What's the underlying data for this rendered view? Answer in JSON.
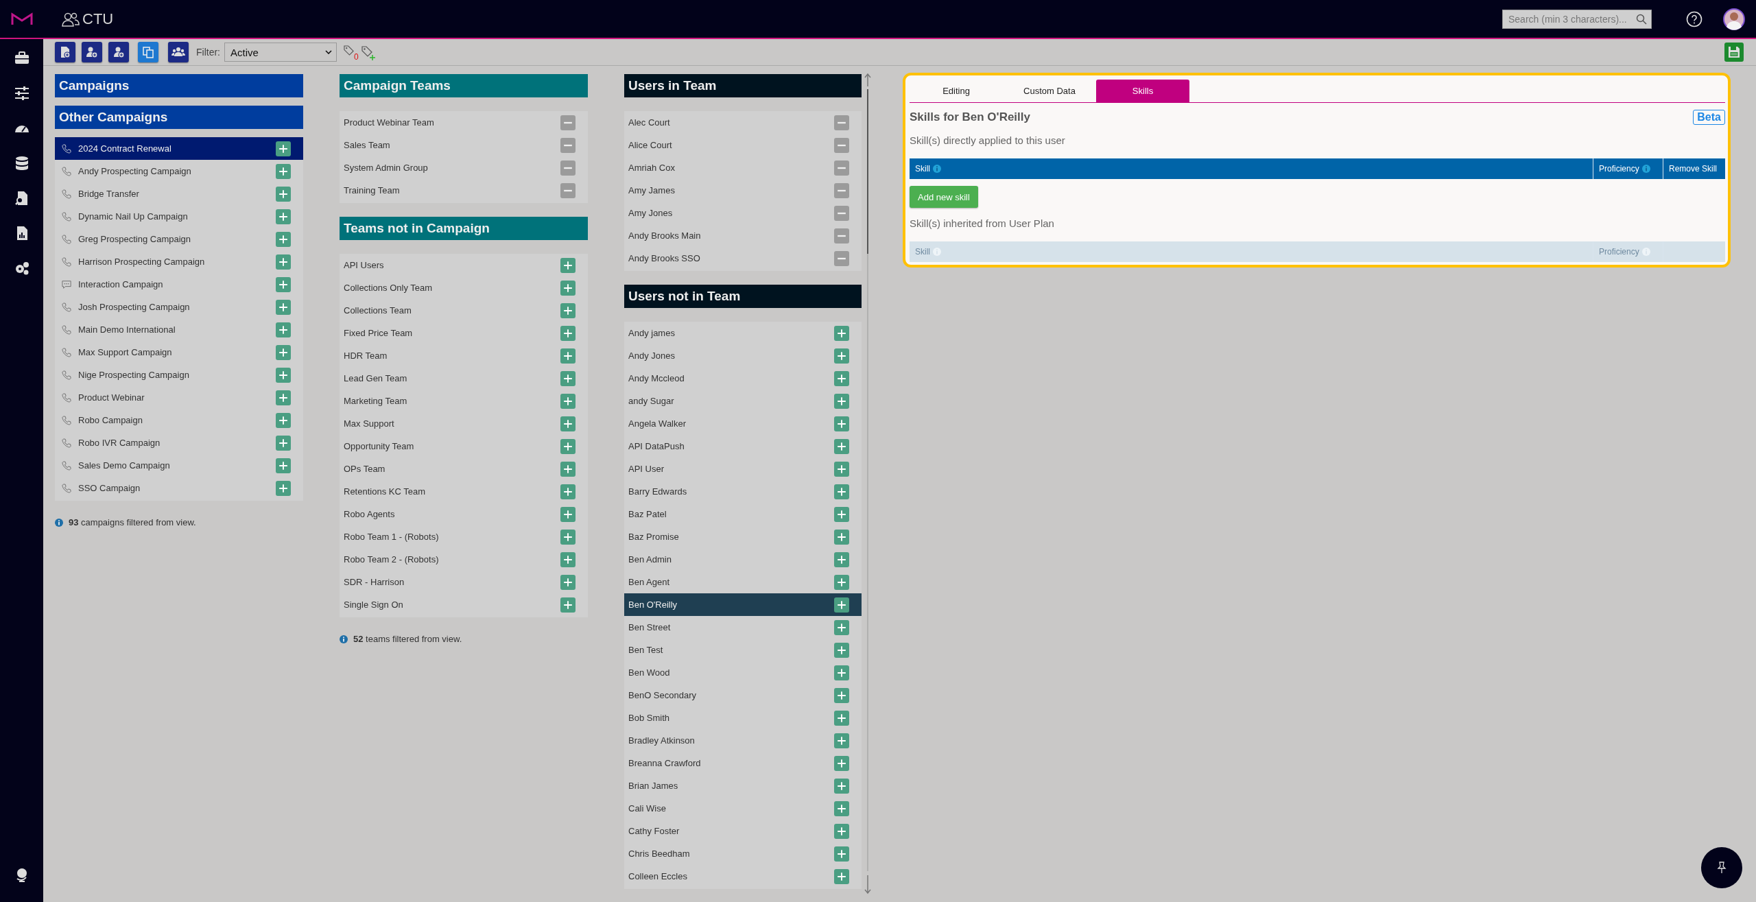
{
  "app": {
    "title": "CTU"
  },
  "search": {
    "placeholder": "Search (min 3 characters)..."
  },
  "toolbar": {
    "filter_label": "Filter:",
    "filter_value": "Active",
    "tag_count": "0"
  },
  "campaigns": {
    "title": "Campaigns",
    "other_title": "Other Campaigns",
    "items": [
      {
        "name": "2024 Contract Renewal",
        "kind": "phone",
        "selected": true
      },
      {
        "name": "Andy Prospecting Campaign",
        "kind": "phone",
        "selected": false
      },
      {
        "name": "Bridge Transfer",
        "kind": "phone",
        "selected": false
      },
      {
        "name": "Dynamic Nail Up Campaign",
        "kind": "phone",
        "selected": false
      },
      {
        "name": "Greg Prospecting Campaign",
        "kind": "phone",
        "selected": false
      },
      {
        "name": "Harrison Prospecting Campaign",
        "kind": "phone",
        "selected": false
      },
      {
        "name": "Interaction Campaign",
        "kind": "chat",
        "selected": false
      },
      {
        "name": "Josh Prospecting Campaign",
        "kind": "phone",
        "selected": false
      },
      {
        "name": "Main Demo International",
        "kind": "phone",
        "selected": false
      },
      {
        "name": "Max Support Campaign",
        "kind": "phone",
        "selected": false
      },
      {
        "name": "Nige Prospecting Campaign",
        "kind": "phone",
        "selected": false
      },
      {
        "name": "Product Webinar",
        "kind": "phone",
        "selected": false
      },
      {
        "name": "Robo Campaign",
        "kind": "phone",
        "selected": false
      },
      {
        "name": "Robo IVR Campaign",
        "kind": "phone",
        "selected": false
      },
      {
        "name": "Sales Demo Campaign",
        "kind": "phone",
        "selected": false
      },
      {
        "name": "SSO Campaign",
        "kind": "phone",
        "selected": false
      }
    ],
    "footer": "**93** campaigns filtered from view."
  },
  "teams": {
    "in_title": "Campaign Teams",
    "in_items": [
      {
        "name": "Product Webinar Team",
        "selected": false
      },
      {
        "name": "Sales Team",
        "selected": false
      },
      {
        "name": "System Admin Group",
        "selected": false
      },
      {
        "name": "Training Team",
        "selected": false
      }
    ],
    "out_title": "Teams not in Campaign",
    "out_items": [
      {
        "name": "API Users",
        "selected": false
      },
      {
        "name": "Collections Only Team",
        "selected": false
      },
      {
        "name": "Collections Team",
        "selected": false
      },
      {
        "name": "Fixed Price Team",
        "selected": false
      },
      {
        "name": "HDR Team",
        "selected": false
      },
      {
        "name": "Lead Gen Team",
        "selected": false
      },
      {
        "name": "Marketing Team",
        "selected": false
      },
      {
        "name": "Max Support",
        "selected": false
      },
      {
        "name": "Opportunity Team",
        "selected": false
      },
      {
        "name": "OPs Team",
        "selected": false
      },
      {
        "name": "Retentions KC Team",
        "selected": false
      },
      {
        "name": "Robo Agents",
        "selected": false
      },
      {
        "name": "Robo Team 1 - (Robots)",
        "selected": false
      },
      {
        "name": "Robo Team 2 - (Robots)",
        "selected": false
      },
      {
        "name": "SDR - Harrison",
        "selected": false
      },
      {
        "name": "Single Sign On",
        "selected": false
      }
    ],
    "footer": "**52** teams filtered from view."
  },
  "users": {
    "in_title": "Users in Team",
    "in_items": [
      {
        "name": "Alec Court",
        "selected": false
      },
      {
        "name": "Alice Court",
        "selected": false
      },
      {
        "name": "Amriah Cox",
        "selected": false
      },
      {
        "name": "Amy James",
        "selected": false
      },
      {
        "name": "Amy Jones",
        "selected": false
      },
      {
        "name": "Andy Brooks Main",
        "selected": false
      },
      {
        "name": "Andy Brooks SSO",
        "selected": false
      }
    ],
    "out_title": "Users not in Team",
    "out_items": [
      {
        "name": "Andy james",
        "selected": false
      },
      {
        "name": "Andy Jones",
        "selected": false
      },
      {
        "name": "Andy Mccleod",
        "selected": false
      },
      {
        "name": "andy Sugar",
        "selected": false
      },
      {
        "name": "Angela Walker",
        "selected": false
      },
      {
        "name": "API DataPush",
        "selected": false
      },
      {
        "name": "API User",
        "selected": false
      },
      {
        "name": "Barry Edwards",
        "selected": false
      },
      {
        "name": "Baz Patel",
        "selected": false
      },
      {
        "name": "Baz Promise",
        "selected": false
      },
      {
        "name": "Ben Admin",
        "selected": false
      },
      {
        "name": "Ben Agent",
        "selected": false
      },
      {
        "name": "Ben O'Reilly",
        "selected": true
      },
      {
        "name": "Ben Street",
        "selected": false
      },
      {
        "name": "Ben Test",
        "selected": false
      },
      {
        "name": "Ben Wood",
        "selected": false
      },
      {
        "name": "BenO Secondary",
        "selected": false
      },
      {
        "name": "Bob Smith",
        "selected": false
      },
      {
        "name": "Bradley Atkinson",
        "selected": false
      },
      {
        "name": "Breanna Crawford",
        "selected": false
      },
      {
        "name": "Brian James",
        "selected": false
      },
      {
        "name": "Cali Wise",
        "selected": false
      },
      {
        "name": "Cathy Foster",
        "selected": false
      },
      {
        "name": "Chris Beedham",
        "selected": false
      },
      {
        "name": "Colleen Eccles",
        "selected": false
      }
    ]
  },
  "skills_panel": {
    "tabs": [
      {
        "label": "Editing",
        "selected": false
      },
      {
        "label": "Custom Data",
        "selected": false
      },
      {
        "label": "Skills",
        "selected": true
      }
    ],
    "title": "Skills for Ben O'Reilly",
    "badge": "Beta",
    "direct_label": "Skill(s) directly applied to this user",
    "direct_columns": [
      {
        "label": "Skill",
        "info": true
      },
      {
        "label": "Proficiency",
        "info": true
      },
      {
        "label": "Remove Skill",
        "info": false
      }
    ],
    "add_button": "Add new skill",
    "inherited_label": "Skill(s) inherited from User Plan",
    "inherited_columns": [
      {
        "label": "Skill",
        "info": true
      },
      {
        "label": "Proficiency",
        "info": true
      }
    ]
  }
}
